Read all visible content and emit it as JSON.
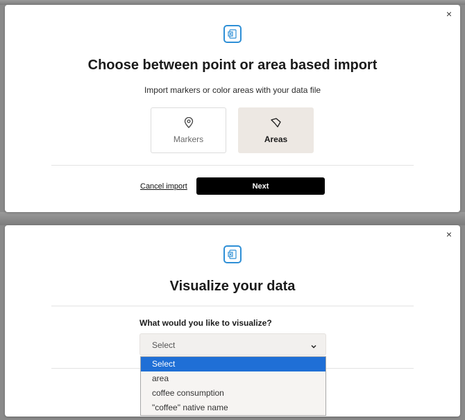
{
  "modal_import": {
    "close_label": "×",
    "title": "Choose between point or area based import",
    "subtitle": "Import markers or color areas with your data file",
    "options": [
      {
        "label": "Markers",
        "icon": "map-pin-icon"
      },
      {
        "label": "Areas",
        "icon": "polygon-icon",
        "selected": true
      }
    ],
    "cancel_label": "Cancel import",
    "next_label": "Next"
  },
  "modal_visualize": {
    "close_label": "×",
    "title": "Visualize your data",
    "question": "What would you like to visualize?",
    "select_value": "Select",
    "dropdown_options": [
      {
        "label": "Select",
        "highlighted": true
      },
      {
        "label": "area"
      },
      {
        "label": "coffee consumption"
      },
      {
        "label": "\"coffee\" native name"
      }
    ]
  },
  "colors": {
    "accent_icon": "#2e8fd6",
    "selected_card": "#ede8e3",
    "primary_button": "#000000",
    "dropdown_highlight": "#1f6fd6"
  }
}
